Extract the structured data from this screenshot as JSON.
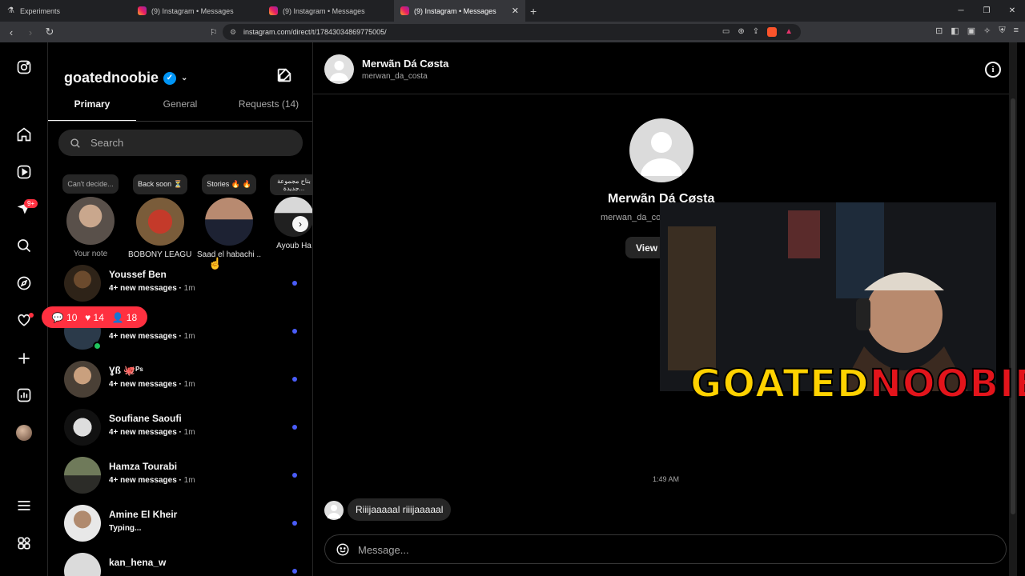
{
  "browser": {
    "tabs": [
      {
        "title": "Experiments",
        "icon": "experiments-icon",
        "active": false
      },
      {
        "title": "(9) Instagram • Messages",
        "icon": "instagram-icon",
        "active": false
      },
      {
        "title": "(9) Instagram • Messages",
        "icon": "instagram-icon",
        "active": false
      },
      {
        "title": "(9) Instagram • Messages",
        "icon": "instagram-icon",
        "active": true
      }
    ],
    "url": "instagram.com/direct/t/17843034869775005/"
  },
  "left_nav": {
    "notification_badge": "9+"
  },
  "inbox": {
    "account": "goatednoobie",
    "tabs": [
      "Primary",
      "General",
      "Requests (14)"
    ],
    "search_placeholder": "Search",
    "notes": [
      {
        "bubble": "Can't decide...",
        "name": "Your note"
      },
      {
        "bubble": "Back soon ⏳",
        "name": "BOBONY LEAGUE"
      },
      {
        "bubble": "Stories 🔥 🔥",
        "name": "Saad el habachi ..."
      },
      {
        "bubble": "بتاح مجموعة جديدة...",
        "name": "Ayoub Ha"
      }
    ],
    "threads": [
      {
        "name": "Youssef Ben",
        "preview": "4+ new messages",
        "time": "1m"
      },
      {
        "name": "",
        "preview": "4+ new messages",
        "time": "1m"
      },
      {
        "name": "Ɣß 🐙ᴾˢ",
        "preview": "4+ new messages",
        "time": "1m"
      },
      {
        "name": "Soufiane Saoufi",
        "preview": "4+ new messages",
        "time": "1m"
      },
      {
        "name": "Hamza Tourabi",
        "preview": "4+ new messages",
        "time": "1m"
      },
      {
        "name": "Amine El Kheir",
        "preview": "Typing...",
        "time": ""
      },
      {
        "name": "kan_hena_w",
        "preview": "",
        "time": ""
      }
    ],
    "activity": {
      "comments": "10",
      "likes": "14",
      "follows": "18"
    }
  },
  "conversation": {
    "name": "Merwãn Dá Cøsta",
    "username": "merwan_da_costa",
    "profile_name": "Merwãn Dá Cøsta",
    "profile_username": "merwan_da_co",
    "view_button": "View",
    "timestamp": "1:49 AM",
    "message": "Riiijaaaaal riiijaaaaal",
    "composer_placeholder": "Message..."
  },
  "overlay": {
    "logo_part1": "GOATED",
    "logo_part2": "NOOBIE",
    "logo_colors": {
      "goated": "#ffd200",
      "noobie": "#e3141b"
    }
  }
}
